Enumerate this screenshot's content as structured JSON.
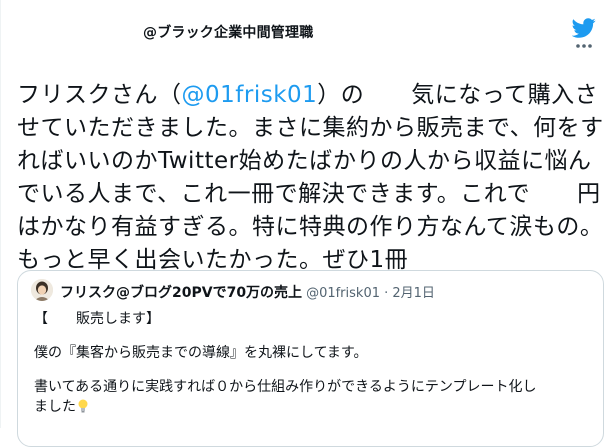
{
  "tweet": {
    "author_name": "@ブラック企業中間管理職",
    "text_before_mention": "フリスクさん（",
    "mention": "@01frisk01",
    "text_after_mention": "）の　　気になって購入させていただきました。まさに集約から販売まで、何をすればいいのかTwitter始めたばかりの人から収益に悩んでいる人まで、これ一冊で解決できます。これで　　円はかなり有益すぎる。特に特典の作り方なんて涙もの。もっと早く出会いたかった。ぜひ1冊",
    "icons": {
      "logo": "twitter-bird-icon",
      "more": "more-options-icon"
    }
  },
  "quoted_tweet": {
    "author_name": "フリスク@ブログ20PVで70万の売上",
    "handle_and_date": "@01frisk01 · 2月1日",
    "lines": [
      "【　　販売します】",
      "僕の『集客から販売までの導線』を丸裸にしてます。",
      "書いてある通りに実践すれば０から仕組み作りができるようにテンプレート化し",
      "ました"
    ],
    "icons": {
      "avatar": "avatar",
      "bulb": "light-bulb-icon"
    }
  },
  "colors": {
    "link": "#1d9bf0",
    "text": "#0f1419",
    "muted": "#536471",
    "border": "#cfd9de"
  }
}
